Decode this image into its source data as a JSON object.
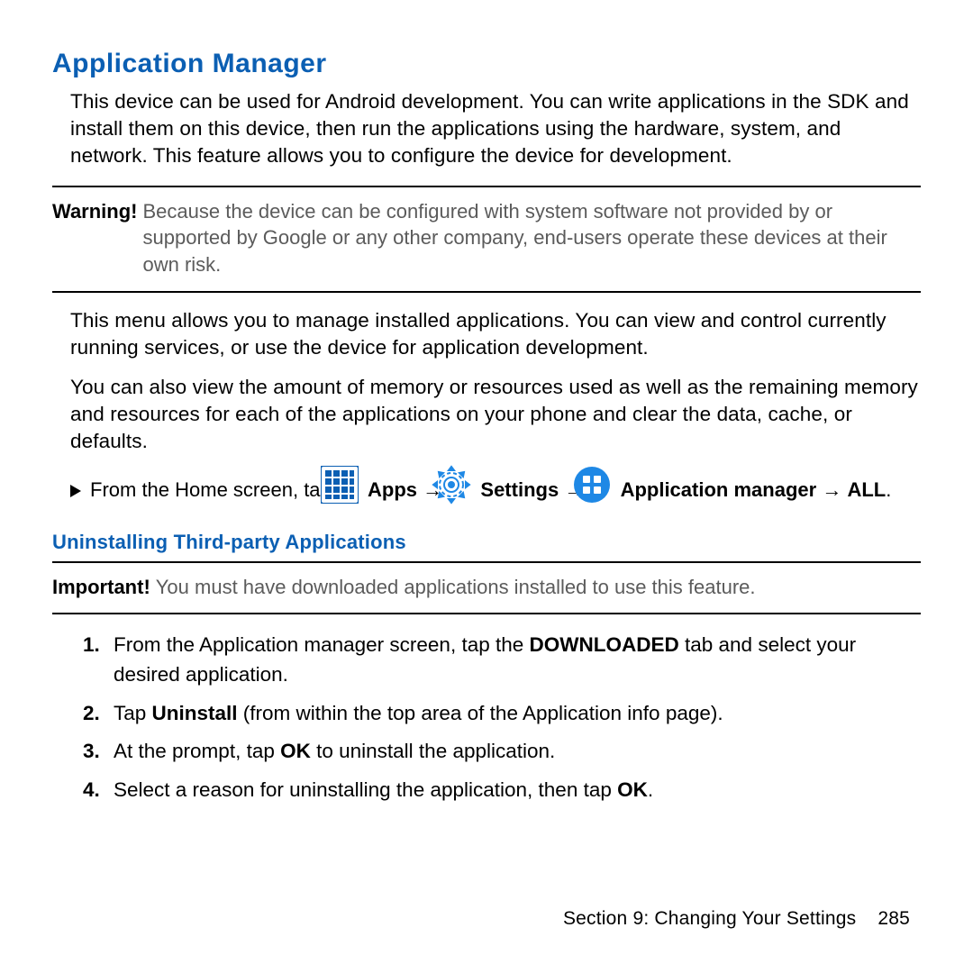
{
  "heading": "Application Manager",
  "intro": "This device can be used for Android development. You can write applications in the SDK and install them on this device, then run the applications using the hardware, system, and network. This feature allows you to configure the device for development.",
  "warning": {
    "label": "Warning!",
    "text": "Because the device can be configured with system software not provided by or supported by Google or any other company, end-users operate these devices at their own risk."
  },
  "para2": "This menu allows you to manage installed applications. You can view and control currently running services, or use the device for application development.",
  "para3": "You can also view the amount of memory or resources used as well as the remaining memory and resources for each of the applications on your phone and clear the data, cache, or defaults.",
  "nav": {
    "lead": "From the Home screen, tap ",
    "apps": "Apps",
    "arrow": "→",
    "settings": "Settings",
    "appmgr1": "Application",
    "appmgr2": "manager",
    "all": "ALL",
    "period": "."
  },
  "subheading": "Uninstalling Third-party Applications",
  "important": {
    "label": "Important!",
    "text": "You must have downloaded applications installed to use this feature."
  },
  "steps": [
    {
      "pre": "From the Application manager screen, tap the ",
      "bold": "DOWNLOADED",
      "post": " tab and select your desired application."
    },
    {
      "pre": "Tap ",
      "bold": "Uninstall",
      "post": " (from within the top area of the Application info page)."
    },
    {
      "pre": "At the prompt, tap ",
      "bold": "OK",
      "post": " to uninstall the application."
    },
    {
      "pre": "Select a reason for uninstalling the application, then tap ",
      "bold": "OK",
      "post": "."
    }
  ],
  "footer": {
    "section": "Section 9:  Changing Your Settings",
    "page": "285"
  },
  "colors": {
    "accent": "#0b5fb3",
    "icon_blue": "#1e88e5"
  }
}
